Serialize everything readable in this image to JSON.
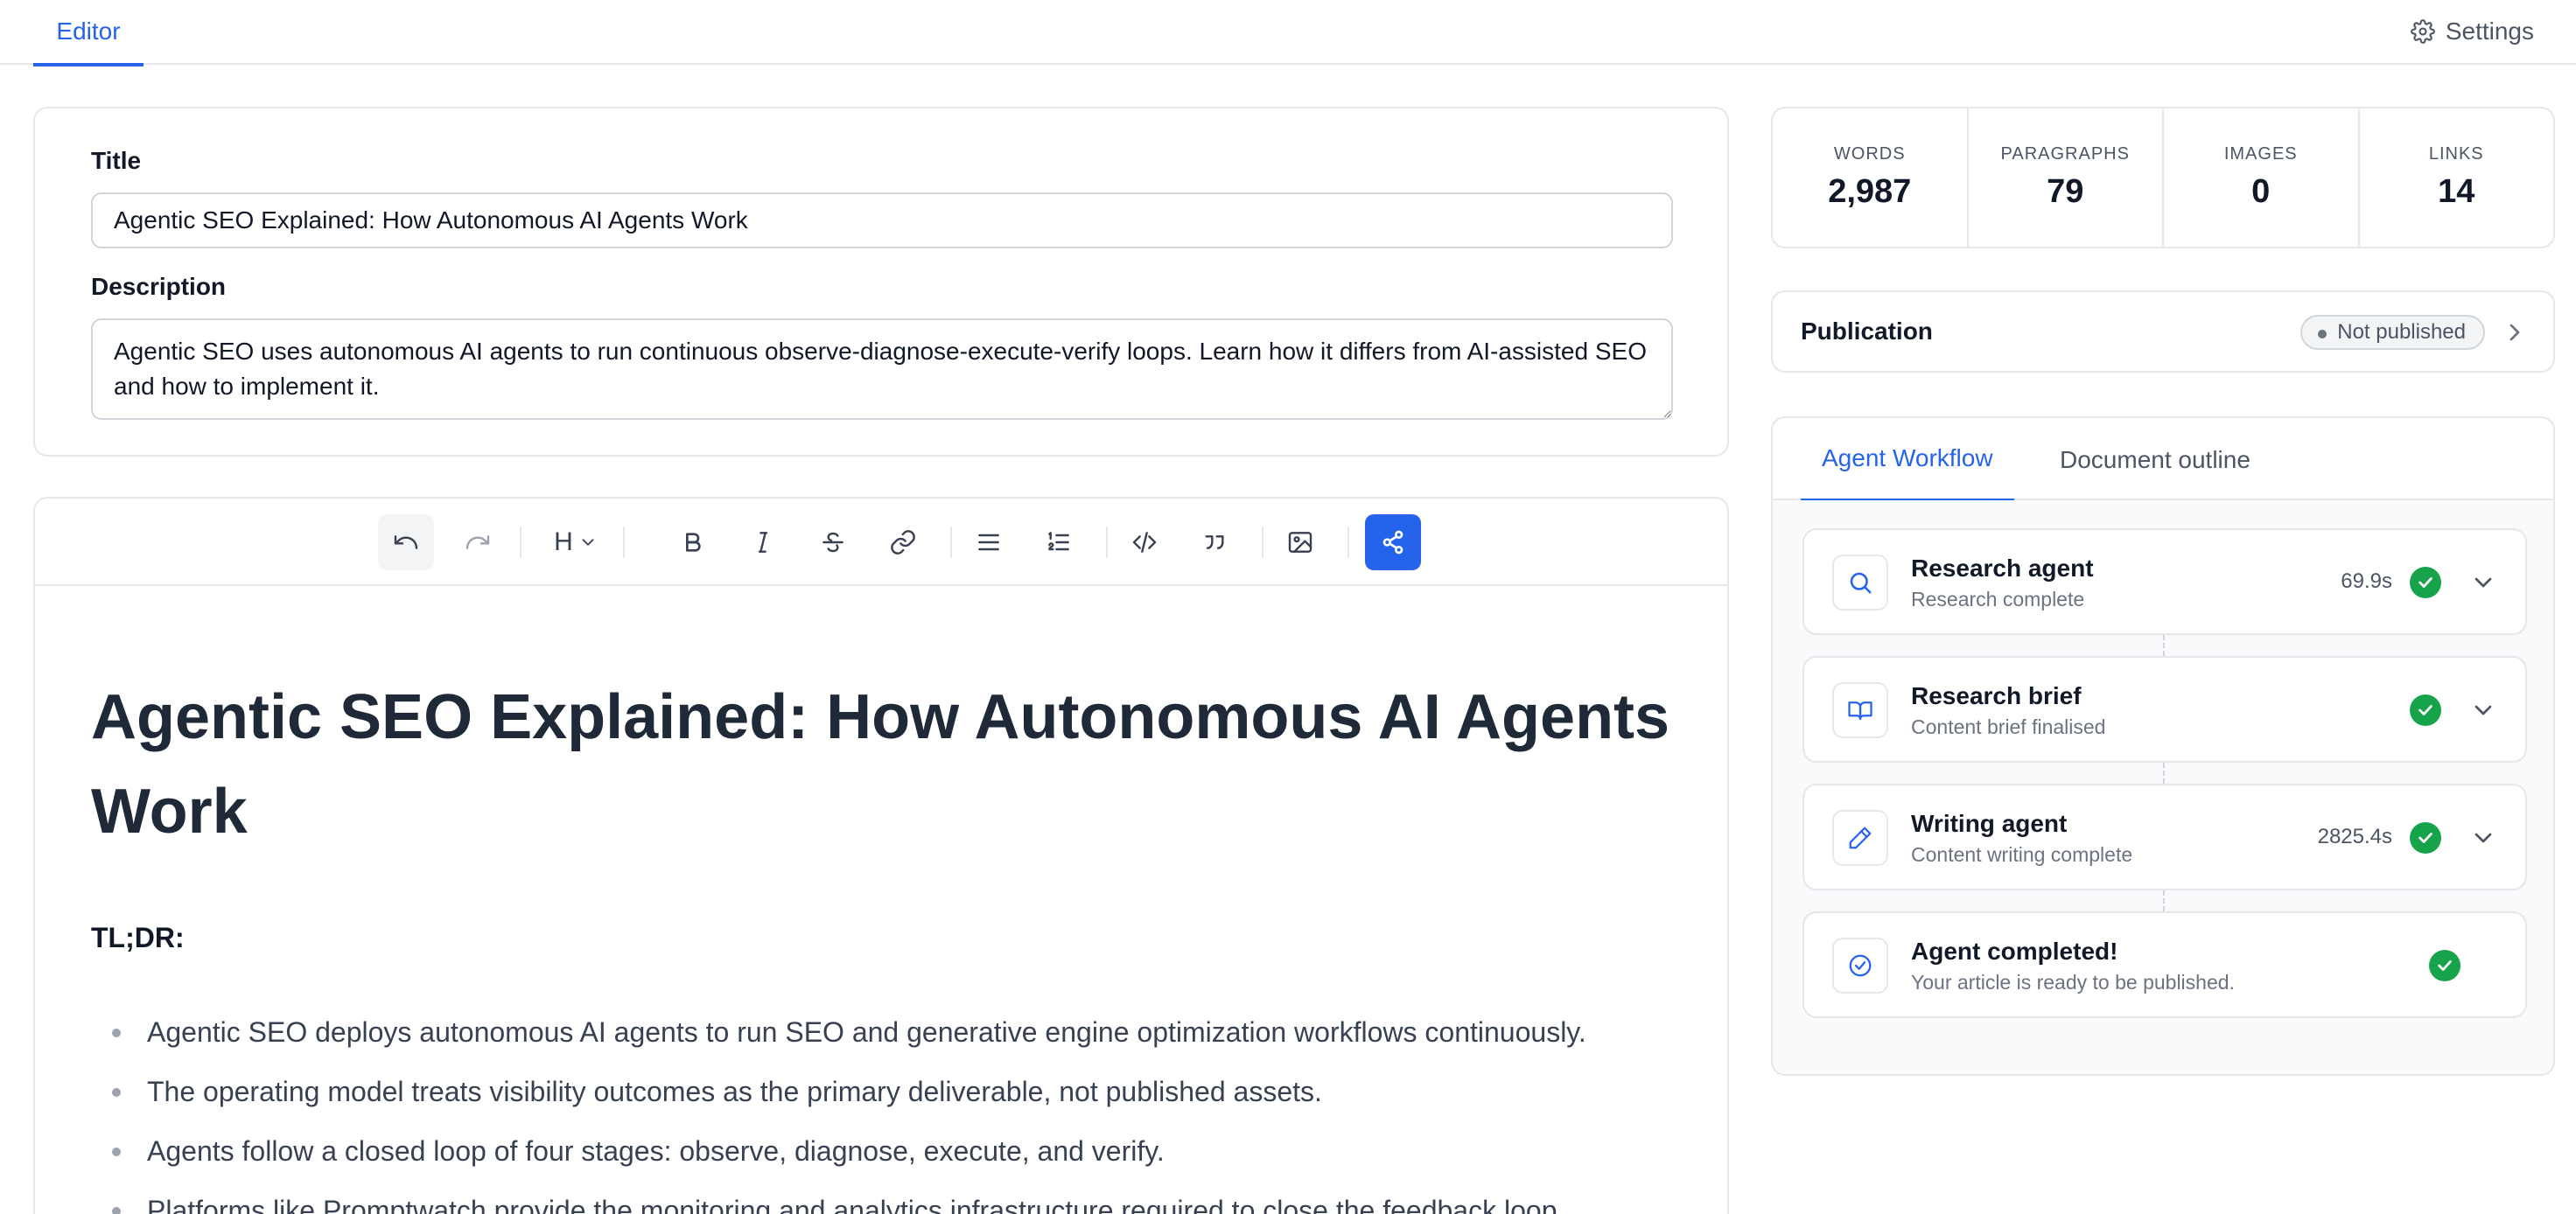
{
  "topbar": {
    "tab_editor": "Editor",
    "settings_label": "Settings"
  },
  "meta": {
    "title_label": "Title",
    "title_value": "Agentic SEO Explained: How Autonomous AI Agents Work",
    "description_label": "Description",
    "description_value": "Agentic SEO uses autonomous AI agents to run continuous observe-diagnose-execute-verify loops. Learn how it differs from AI-assisted SEO and how to implement it."
  },
  "toolbar": {
    "heading_label": "H",
    "icons": [
      "undo-icon",
      "redo-icon",
      "heading-icon",
      "bold-icon",
      "italic-icon",
      "strikethrough-icon",
      "link-icon",
      "bullet-list-icon",
      "ordered-list-icon",
      "code-icon",
      "quote-icon",
      "image-icon",
      "share-icon"
    ]
  },
  "document": {
    "heading": "Agentic SEO Explained: How Autonomous AI Agents Work",
    "tldr": "TL;DR:",
    "bullets": [
      "Agentic SEO deploys autonomous AI agents to run SEO and generative engine optimization workflows continuously.",
      "The operating model treats visibility outcomes as the primary deliverable, not published assets.",
      "Agents follow a closed loop of four stages: observe, diagnose, execute, and verify.",
      "Platforms like Promptwatch provide the monitoring and analytics infrastructure required to close the feedback loop"
    ]
  },
  "stats": [
    {
      "label": "WORDS",
      "value": "2,987"
    },
    {
      "label": "PARAGRAPHS",
      "value": "79"
    },
    {
      "label": "IMAGES",
      "value": "0"
    },
    {
      "label": "LINKS",
      "value": "14"
    }
  ],
  "publication": {
    "title": "Publication",
    "status": "Not published"
  },
  "workflow": {
    "tabs": [
      "Agent Workflow",
      "Document outline"
    ],
    "steps": [
      {
        "title": "Research agent",
        "subtitle": "Research complete",
        "time": "69.9s",
        "icon": "search-icon"
      },
      {
        "title": "Research brief",
        "subtitle": "Content brief finalised",
        "time": "",
        "icon": "book-open-icon"
      },
      {
        "title": "Writing agent",
        "subtitle": "Content writing complete",
        "time": "2825.4s",
        "icon": "pencil-icon"
      },
      {
        "title": "Agent completed!",
        "subtitle": "Your article is ready to be published.",
        "time": "",
        "icon": "check-circle-icon"
      }
    ]
  },
  "colors": {
    "accent": "#2563eb",
    "success": "#16a34a",
    "border": "#e5e7eb"
  }
}
